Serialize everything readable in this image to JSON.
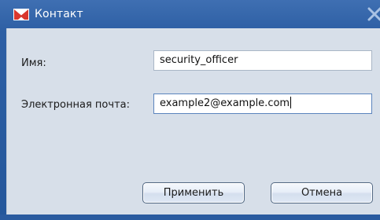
{
  "window": {
    "title": "Контакт",
    "accent_color": "#2d5fa4",
    "icons": {
      "app": "envelope-icon",
      "close": "close-icon"
    }
  },
  "form": {
    "name_label": "Имя:",
    "name_value": "security_officer",
    "email_label": "Электронная почта:",
    "email_value": "example2@example.com"
  },
  "buttons": {
    "apply_label": "Применить",
    "cancel_label": "Отмена"
  }
}
